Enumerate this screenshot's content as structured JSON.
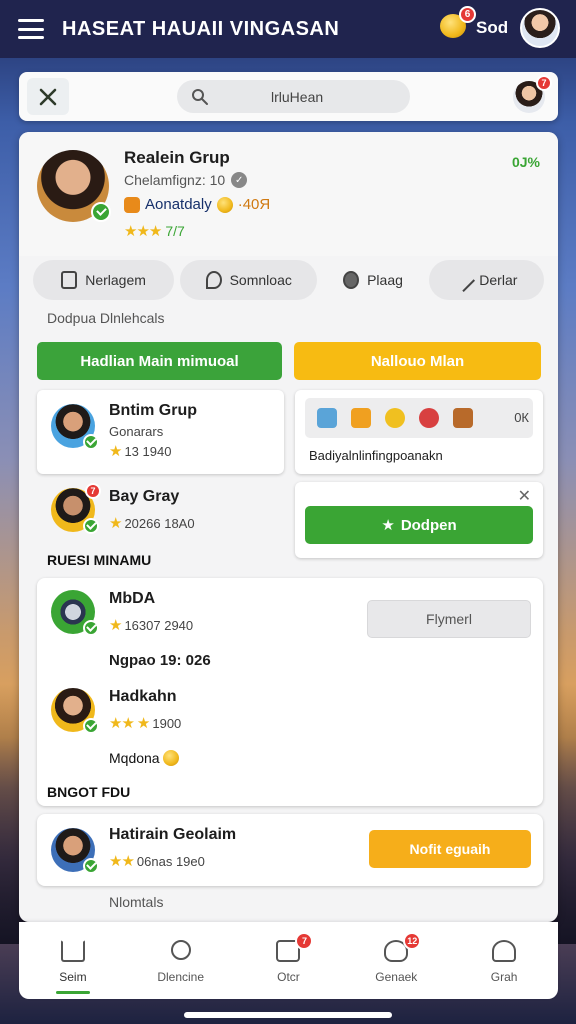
{
  "topbar": {
    "title": "HASEAT HAUAII VINGASAN",
    "coin_badge": "6",
    "user_label": "Sod"
  },
  "search": {
    "value": "lrluHean",
    "avatar_badge": "7"
  },
  "profile": {
    "name": "Realein Grup",
    "subtitle": "Chelamfignz: 10",
    "location": "Aonatdaly",
    "location_value": "·40Я",
    "rating_text": "7/7",
    "count": "0J%"
  },
  "tabs": [
    {
      "label": "Nerlagem",
      "icon": "lock-icon"
    },
    {
      "label": "Somnloac",
      "icon": "chat-icon"
    },
    {
      "label": "Plaag",
      "icon": "pin-icon"
    },
    {
      "label": "Derlar",
      "icon": "pen-icon"
    }
  ],
  "section_label": "Dodpua Dlnlehcals",
  "buttons": {
    "primary": "Hadlian Main mimuoal",
    "secondary": "Nallouo Mlan"
  },
  "cards": {
    "c1": {
      "name": "Bntim Grup",
      "sub": "Gonarars",
      "meta": "13 1940"
    },
    "c2": {
      "name": "Bay Gray",
      "meta": "20266 18A0",
      "badge": "7"
    },
    "feature": {
      "count": "0К",
      "caption": "Badiyalnlinfingpoanakn"
    },
    "accept": {
      "label": "Dodpen"
    }
  },
  "section2": "RUESI MINAMU",
  "list": {
    "r1": {
      "name": "MbDA",
      "meta": "16307 2940",
      "action": "Flymerl"
    },
    "r1_sub": "Ngpao 19: 026",
    "r2": {
      "name": "Hadkahn",
      "meta": "1900"
    },
    "r2_sub": "Mqdona"
  },
  "section3": "BNGOT FDU",
  "last": {
    "name": "Hatirain Geolaim",
    "meta": "06nas 19e0",
    "action": "Nofit eguaih"
  },
  "footer_label": "Nlomtals",
  "nav": [
    {
      "label": "Seim",
      "icon": "home-icon",
      "active": true
    },
    {
      "label": "Dlencine",
      "icon": "friends-icon"
    },
    {
      "label": "Otcr",
      "icon": "chat-icon",
      "badge": "7"
    },
    {
      "label": "Genaek",
      "icon": "group-icon",
      "badge": "12"
    },
    {
      "label": "Grah",
      "icon": "profile-icon"
    }
  ]
}
